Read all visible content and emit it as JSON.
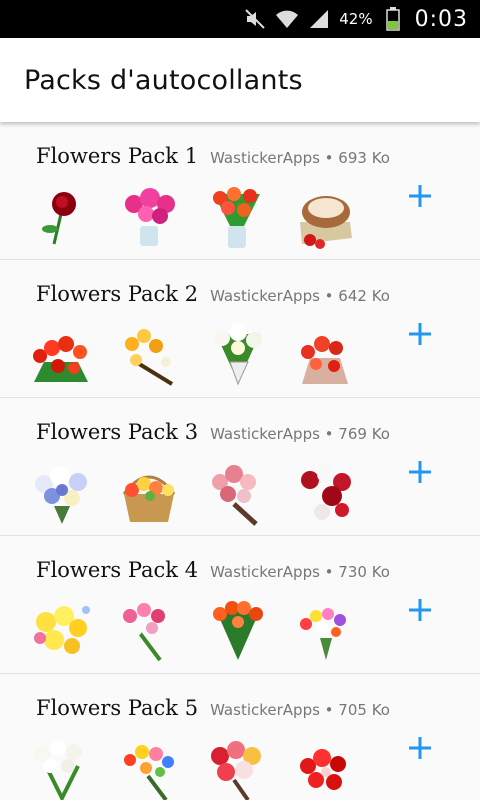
{
  "status_bar": {
    "icons": [
      "mute-icon",
      "wifi-icon",
      "signal-icon",
      "battery-icon"
    ],
    "battery_percent": "42%",
    "battery_level": 0.42,
    "time": "0:03"
  },
  "app_bar": {
    "title": "Packs d'autocollants"
  },
  "accent_color": "#2196f3",
  "packs": [
    {
      "name": "Flowers Pack 1",
      "publisher": "WastickerApps",
      "size": "693 Ko",
      "stickers": [
        "red-rose-sticker",
        "pink-tulips-vase-sticker",
        "red-tulips-vase-sticker",
        "cake-with-roses-sticker"
      ]
    },
    {
      "name": "Flowers Pack 2",
      "publisher": "WastickerApps",
      "size": "642 Ko",
      "stickers": [
        "red-tulip-bouquet-sticker",
        "yellow-bouquet-sticker",
        "white-lily-bouquet-sticker",
        "red-tulips-sticker"
      ]
    },
    {
      "name": "Flowers Pack 3",
      "publisher": "WastickerApps",
      "size": "769 Ko",
      "stickers": [
        "mixed-white-bouquet-sticker",
        "flower-basket-sticker",
        "pink-rose-bouquet-sticker",
        "red-white-roses-sticker"
      ]
    },
    {
      "name": "Flowers Pack 4",
      "publisher": "WastickerApps",
      "size": "730 Ko",
      "stickers": [
        "yellow-roses-sticker",
        "pink-tulip-bouquet-sticker",
        "orange-tulips-sticker",
        "spring-bouquet-sticker"
      ]
    },
    {
      "name": "Flowers Pack 5",
      "publisher": "WastickerApps",
      "size": "705 Ko",
      "stickers": [
        "white-tulips-sticker",
        "colorful-bouquet-sticker",
        "rose-bouquet-sticker",
        "red-flowers-sticker"
      ]
    }
  ]
}
